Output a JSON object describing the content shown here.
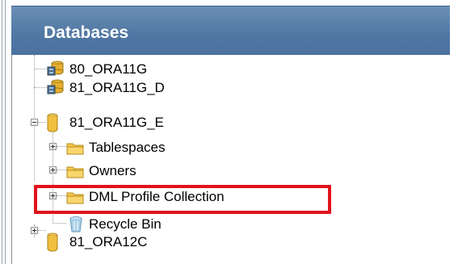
{
  "panel": {
    "title": "Databases"
  },
  "tree": {
    "nodes": [
      {
        "label": "80_ORA11G",
        "icon": "database-stack-icon"
      },
      {
        "label": "81_ORA11G_D",
        "icon": "database-stack-icon"
      },
      {
        "label": "81_ORA11G_E",
        "icon": "database-icon",
        "expanded": true
      },
      {
        "label": "Tablespaces",
        "icon": "folder-icon"
      },
      {
        "label": "Owners",
        "icon": "folder-icon"
      },
      {
        "label": "DML Profile Collection",
        "icon": "folder-icon"
      },
      {
        "label": "Recycle Bin",
        "icon": "recycle-bin-icon"
      },
      {
        "label": "81_ORA12C",
        "icon": "database-icon"
      }
    ]
  },
  "colors": {
    "header_bg": "#5077a3",
    "highlight": "#e2121c",
    "folder": "#f5c84a"
  }
}
